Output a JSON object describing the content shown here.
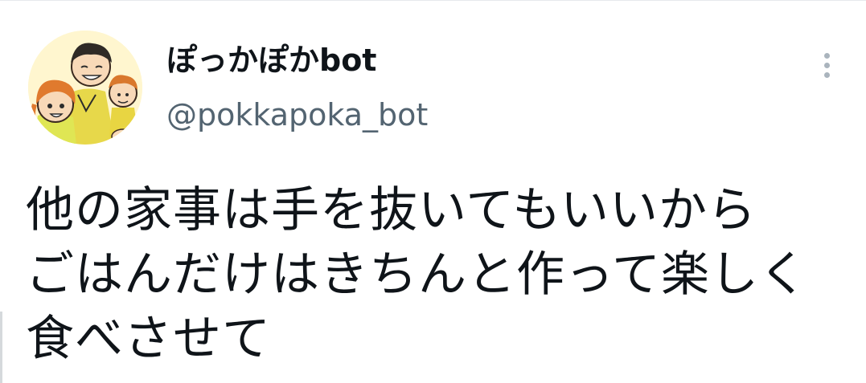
{
  "tweet": {
    "display_name": "ぽっかぽかbot",
    "handle": "@pokkapoka_bot",
    "text_lines": [
      "他の家事は手を抜いてもいいから",
      "ごはんだけはきちんと作って楽しく",
      "食べさせて"
    ],
    "avatar_icon": "cartoon-family-avatar",
    "more_icon": "vertical-ellipsis-icon"
  }
}
